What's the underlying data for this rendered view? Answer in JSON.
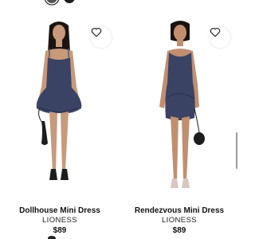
{
  "products": [
    {
      "name": "Dollhouse Mini Dress",
      "brand": "LIONESS",
      "price": "$89"
    },
    {
      "name": "Rendezvous Mini Dress",
      "brand": "LIONESS",
      "price": "$89"
    }
  ],
  "colors": {
    "dress": "#3a4363",
    "text": "#111111",
    "swatch_selected": "#555555",
    "swatch_other": "#1f1f1f"
  },
  "icons": {
    "wishlist": "heart-icon"
  }
}
